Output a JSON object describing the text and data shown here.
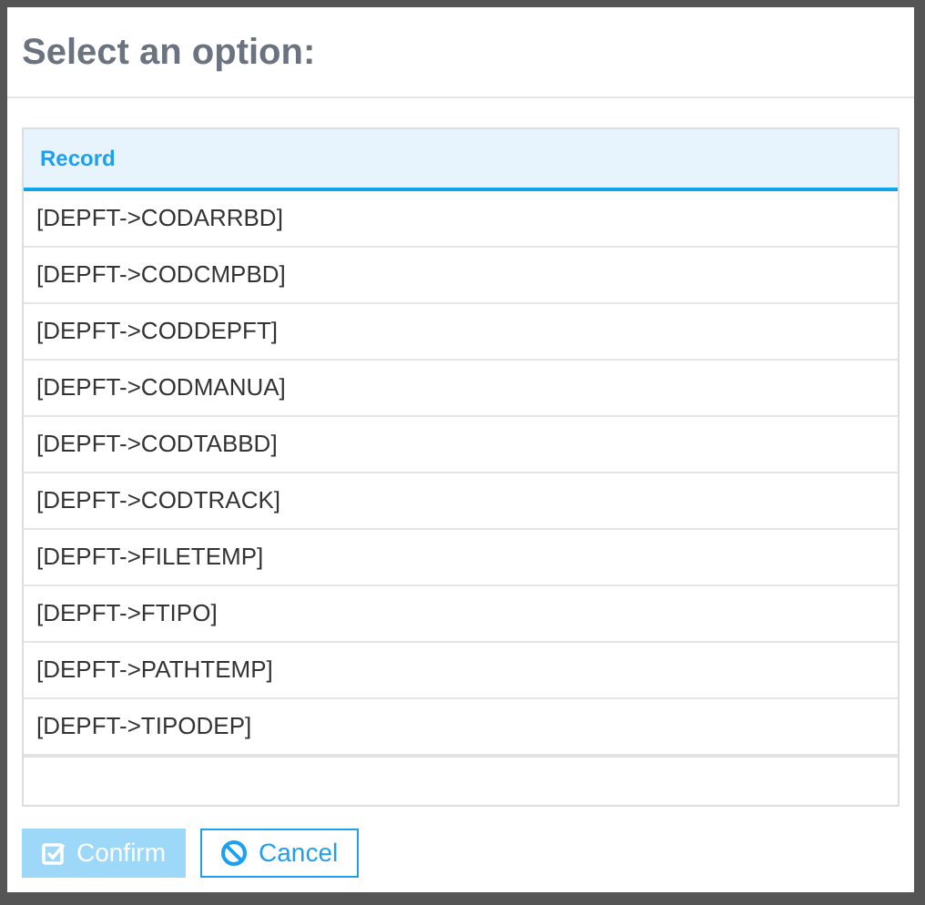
{
  "dialog": {
    "title": "Select an option:"
  },
  "table": {
    "columns": [
      "Record"
    ],
    "rows": [
      {
        "cell": "[DEPFT->CODARRBD]"
      },
      {
        "cell": "[DEPFT->CODCMPBD]"
      },
      {
        "cell": "[DEPFT->CODDEPFT]"
      },
      {
        "cell": "[DEPFT->CODMANUA]"
      },
      {
        "cell": "[DEPFT->CODTABBD]"
      },
      {
        "cell": "[DEPFT->CODTRACK]"
      },
      {
        "cell": "[DEPFT->FILETEMP]"
      },
      {
        "cell": "[DEPFT->FTIPO]"
      },
      {
        "cell": "[DEPFT->PATHTEMP]"
      },
      {
        "cell": "[DEPFT->TIPODEP]"
      }
    ]
  },
  "buttons": [
    {
      "label": "Confirm",
      "kind": "confirm",
      "disabled": true
    },
    {
      "label": "Cancel",
      "kind": "cancel",
      "disabled": false
    }
  ]
}
